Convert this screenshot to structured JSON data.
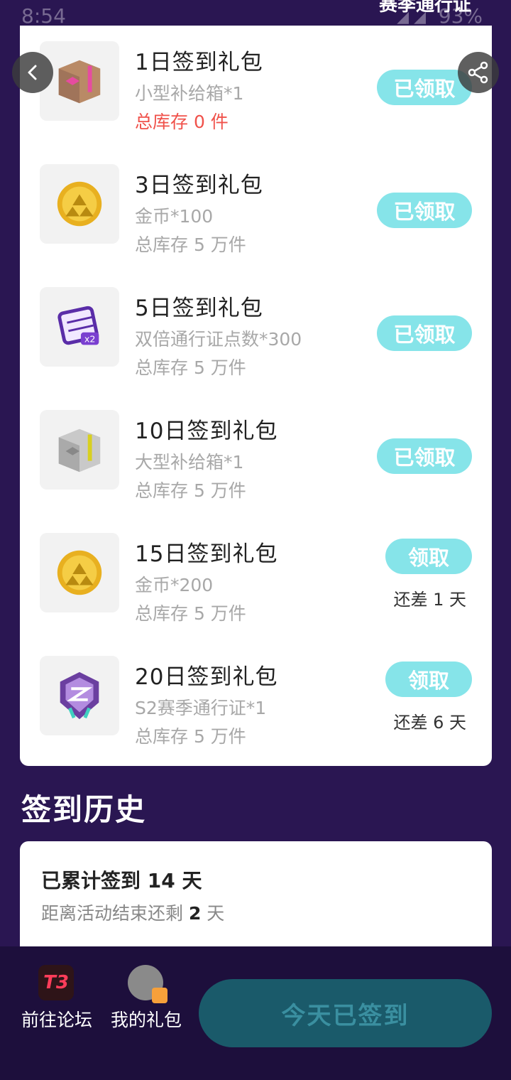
{
  "status": {
    "time": "8:54",
    "battery": "93%"
  },
  "header": {
    "title": "赛季通行证"
  },
  "rewards": [
    {
      "title": "1日签到礼包",
      "item": "小型补给箱*1",
      "stock": "总库存 0 件",
      "stock_out": true,
      "button": "已领取",
      "icon": "small-supply-box-icon"
    },
    {
      "title": "3日签到礼包",
      "item": "金币*100",
      "stock": "总库存 5 万件",
      "button": "已领取",
      "icon": "gold-coin-icon"
    },
    {
      "title": "5日签到礼包",
      "item": "双倍通行证点数*300",
      "stock": "总库存 5 万件",
      "button": "已领取",
      "icon": "double-pass-points-icon"
    },
    {
      "title": "10日签到礼包",
      "item": "大型补给箱*1",
      "stock": "总库存 5 万件",
      "button": "已领取",
      "icon": "large-supply-box-icon"
    },
    {
      "title": "15日签到礼包",
      "item": "金币*200",
      "stock": "总库存 5 万件",
      "button": "领取",
      "remaining": "还差 1 天",
      "icon": "gold-coin-icon"
    },
    {
      "title": "20日签到礼包",
      "item": "S2赛季通行证*1",
      "stock": "总库存 5 万件",
      "button": "领取",
      "remaining": "还差 6 天",
      "icon": "season-pass-badge-icon"
    }
  ],
  "history": {
    "section_title": "签到历史",
    "total_label": "已累计签到 14 天",
    "remain_prefix": "距离活动结束还剩 ",
    "remain_days": "2",
    "remain_suffix": " 天"
  },
  "bottom": {
    "forum_icon_text": "T3",
    "forum_label": "前往论坛",
    "gifts_label": "我的礼包",
    "checkin_label": "今天已签到"
  },
  "colors": {
    "accent": "#86e4e9",
    "background": "#2a1652",
    "out_of_stock": "#f0524b"
  }
}
